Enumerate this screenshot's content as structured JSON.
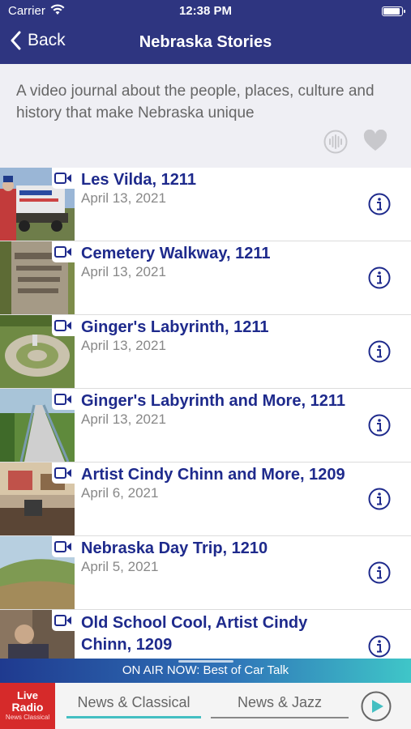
{
  "status_bar": {
    "carrier": "Carrier",
    "time": "12:38 PM"
  },
  "nav": {
    "back_label": "Back",
    "title": "Nebraska Stories"
  },
  "header": {
    "description": "A video journal about the people, places, culture and history that make Nebraska unique"
  },
  "episodes": [
    {
      "title": "Les Vilda, 1211",
      "date": "April 13, 2021"
    },
    {
      "title": "Cemetery Walkway, 1211",
      "date": "April 13, 2021"
    },
    {
      "title": "Ginger's Labyrinth, 1211",
      "date": "April 13, 2021"
    },
    {
      "title": "Ginger's Labyrinth and More, 1211",
      "date": "April 13, 2021"
    },
    {
      "title": "Artist Cindy Chinn and More, 1209",
      "date": "April 6, 2021"
    },
    {
      "title": "Nebraska Day Trip, 1210",
      "date": "April 5, 2021"
    },
    {
      "title": "Old School Cool, Artist Cindy Chinn, 1209",
      "date": ""
    }
  ],
  "on_air": {
    "text": "ON AIR NOW: Best of Car Talk"
  },
  "player": {
    "logo_line1": "Live",
    "logo_line2": "Radio",
    "logo_line3": "News Classical",
    "tab1": "News & Classical",
    "tab2": "News & Jazz"
  },
  "colors": {
    "nav_background": "#2e3580",
    "title_text": "#1e2a8c",
    "accent_teal": "#44bfc2",
    "logo_red": "#d62a2a"
  }
}
